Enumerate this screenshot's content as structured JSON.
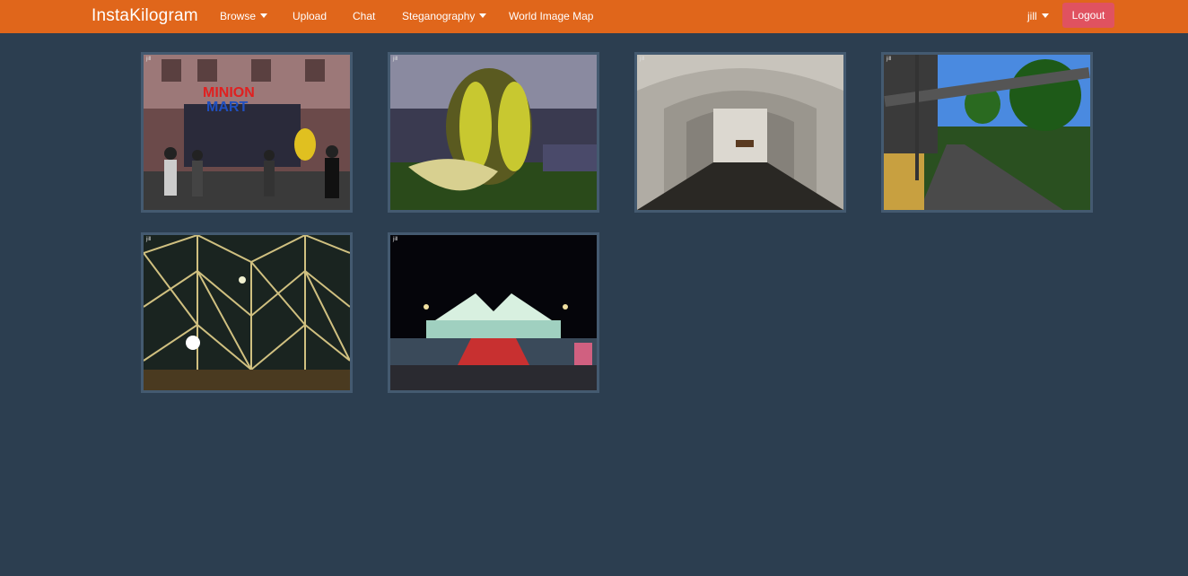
{
  "app": {
    "brand": "InstaKilogram"
  },
  "nav": {
    "browse": "Browse",
    "upload": "Upload",
    "chat": "Chat",
    "steganography": "Steganography",
    "world_map": "World Image Map",
    "user": "jill",
    "logout": "Logout"
  },
  "gallery": [
    {
      "owner": "jill",
      "alt": "MINION MART"
    },
    {
      "owner": "jill",
      "alt": ""
    },
    {
      "owner": "jill",
      "alt": ""
    },
    {
      "owner": "jill",
      "alt": ""
    },
    {
      "owner": "jill",
      "alt": ""
    },
    {
      "owner": "jill",
      "alt": ""
    }
  ],
  "colors": {
    "navbar": "#e0661b",
    "background": "#2c3e50",
    "logout": "#e05260"
  }
}
